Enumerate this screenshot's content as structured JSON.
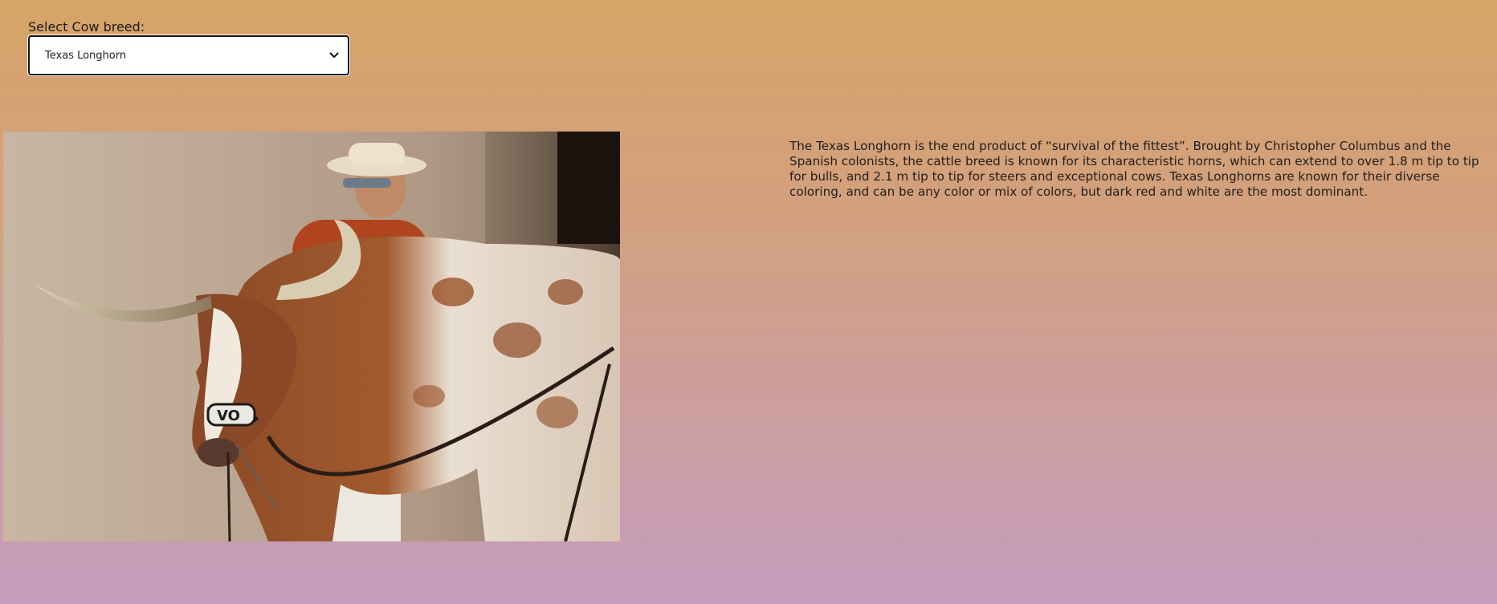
{
  "selector": {
    "label": "Select Cow breed:",
    "selected_value": "Texas Longhorn",
    "icon": "chevron-down-icon"
  },
  "photo": {
    "subject": "Texas Longhorn cattle with handler",
    "halter_text": "VO"
  },
  "description": {
    "text": "The Texas Longhorn is the end product of “survival of the fittest”. Brought by Christopher Columbus and the Spanish colonists, the cattle breed is known for its characteristic horns, which can extend to over 1.8 m tip to tip for bulls, and 2.1 m tip to tip for steers and exceptional cows. Texas Longhorns are known for their diverse coloring, and can be any color or mix of colors, but dark red and white are the most dominant."
  },
  "colors": {
    "background_top": "#d6a466",
    "background_bottom": "#c59cbd",
    "select_border": "#111111"
  }
}
